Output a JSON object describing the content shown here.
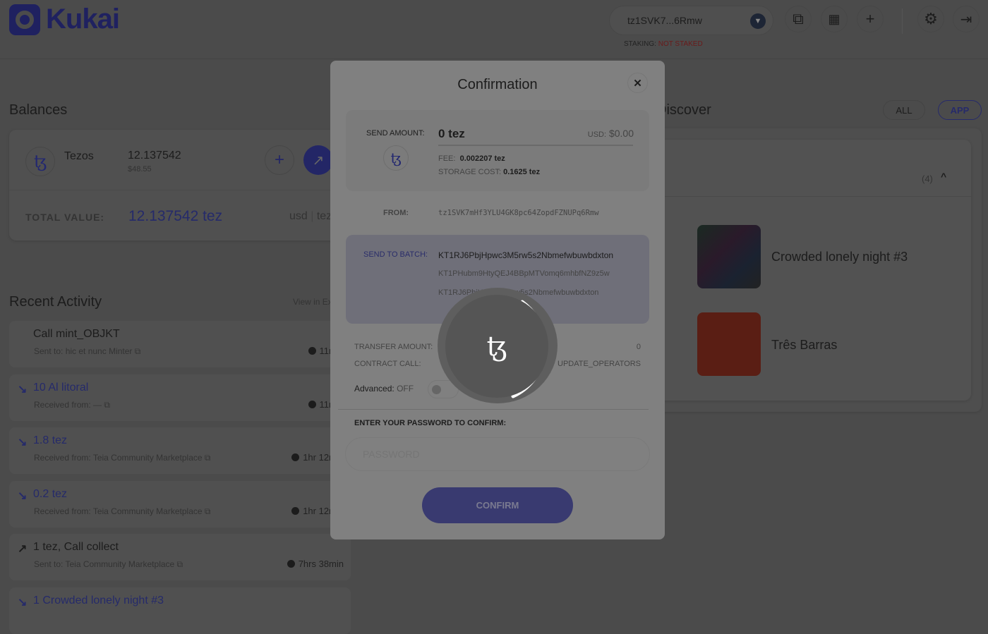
{
  "brand": {
    "name": "Kukai",
    "color": "#1f2160"
  },
  "header": {
    "account": "tz1SVK7...6Rmw",
    "staking_label": "STAKING:",
    "staking_value": "NOT STAKED"
  },
  "balances": {
    "title": "Balances",
    "token": "Tezos",
    "amount": "12.137542",
    "usd": "$48.55",
    "total_label": "TOTAL VALUE:",
    "total_value": "12.137542 tez",
    "unit_usd": "usd",
    "unit_sep": "|",
    "unit_tez": "tez"
  },
  "activity": {
    "title": "Recent Activity",
    "view_link": "View in Explorer",
    "items": [
      {
        "title": "Call mint_OBJKT",
        "sub": "Sent to: hic et nunc Minter",
        "time": "11min",
        "dir": "none"
      },
      {
        "title": "10 Al litoral",
        "sub": "Received from: —",
        "time": "11min",
        "dir": "in"
      },
      {
        "title": "1.8 tez",
        "sub": "Received from: Teia Community Marketplace",
        "time": "1hr 12min",
        "dir": "in"
      },
      {
        "title": "0.2 tez",
        "sub": "Received from: Teia Community Marketplace",
        "time": "1hr 12min",
        "dir": "in"
      },
      {
        "title": "1 tez, Call collect",
        "sub": "Sent to: Teia Community Marketplace",
        "time": "7hrs 38min",
        "dir": "out"
      },
      {
        "title": "1 Crowded lonely night #3",
        "sub": "",
        "time": "",
        "dir": "in"
      }
    ]
  },
  "discover": {
    "title": "Discover",
    "filters": [
      "ALL",
      "APP"
    ],
    "count": "(4)",
    "nfts": [
      "Crowded lonely night #3",
      "Três Barras"
    ]
  },
  "modal": {
    "title": "Confirmation",
    "send_amount_label": "SEND AMOUNT:",
    "amount": "0 tez",
    "usd_label": "USD:",
    "usd_value": "$0.00",
    "fee_label": "FEE:",
    "fee": "0.002207 tez",
    "storage_label": "STORAGE COST:",
    "storage": "0.1625 tez",
    "from_label": "FROM:",
    "from": "tz1SVK7mHf3YLU4GK8pc64ZopdFZNUPq6Rmw",
    "batch_label": "SEND TO BATCH:",
    "batch": [
      "KT1RJ6PbjHpwc3M5rw5s2Nbmefwbuwbdxton",
      "KT1PHubm9HtyQEJ4BBpMTVomq6mhbfNZ9z5w",
      "KT1RJ6PbjHpwc3M5rw5s2Nbmefwbuwbdxton"
    ],
    "transfer_label": "TRANSFER AMOUNT:",
    "transfer": "0",
    "contract_label": "CONTRACT CALL:",
    "contract": "UPDATE_OPERATORS",
    "advanced_label": "Advanced:",
    "advanced_state": "OFF",
    "password_label": "ENTER YOUR PASSWORD TO CONFIRM:",
    "password_placeholder": "PASSWORD",
    "confirm": "CONFIRM"
  },
  "icons": {
    "tezos": "ꜩ",
    "loader": "spinner-tezos"
  }
}
